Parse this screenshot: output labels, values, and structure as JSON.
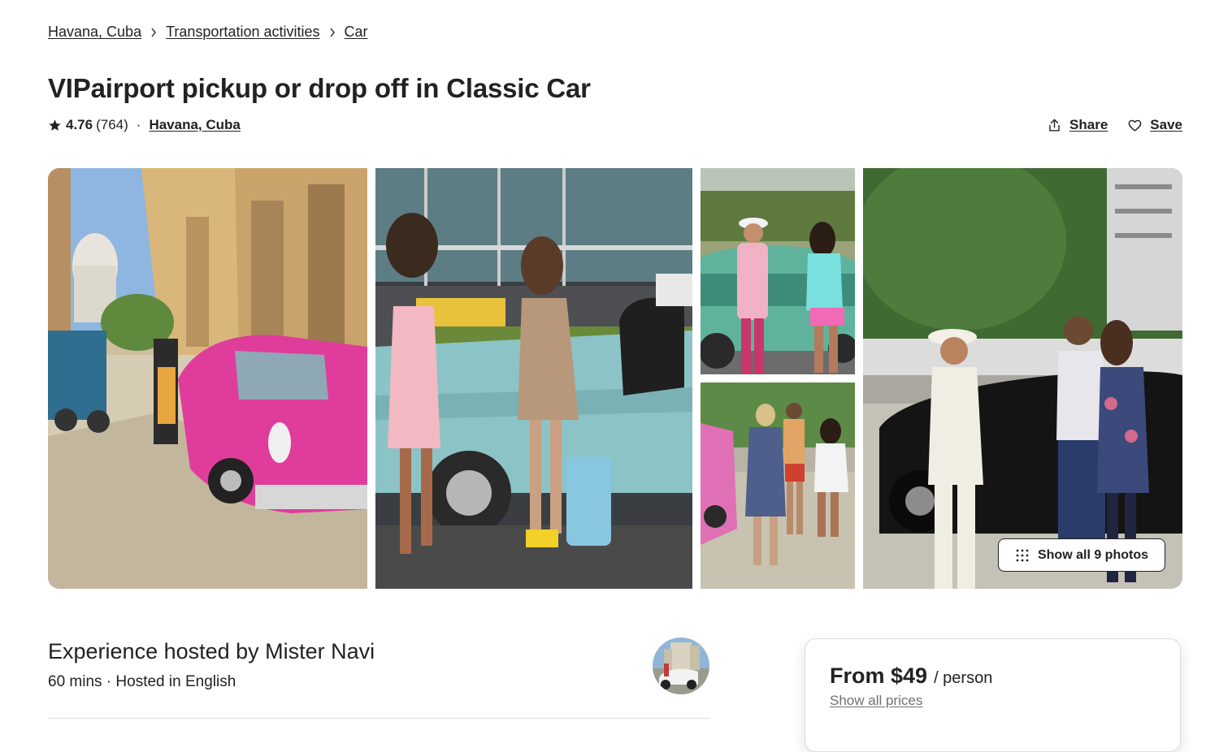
{
  "breadcrumb": {
    "items": [
      "Havana, Cuba",
      "Transportation activities",
      "Car"
    ]
  },
  "listing": {
    "title": "VIPairport pickup or drop off in Classic Car",
    "rating": "4.76",
    "review_count": "(764)",
    "separator": "·",
    "location": "Havana, Cuba"
  },
  "actions": {
    "share_label": "Share",
    "save_label": "Save"
  },
  "gallery": {
    "show_all_label": "Show all 9 photos",
    "photos": [
      "street-pink-classic-car",
      "women-turquoise-classic-car",
      "greeting-green-classic-car",
      "group-street-pink-car",
      "greeting-black-classic-car"
    ]
  },
  "host": {
    "heading": "Experience hosted by Mister Navi",
    "subtitle": "60 mins · Hosted in English"
  },
  "price": {
    "main": "From $49",
    "unit": "/ person",
    "link": "Show all prices"
  },
  "colors": {
    "text": "#222222",
    "muted": "#717171",
    "divider": "#dddddd"
  }
}
